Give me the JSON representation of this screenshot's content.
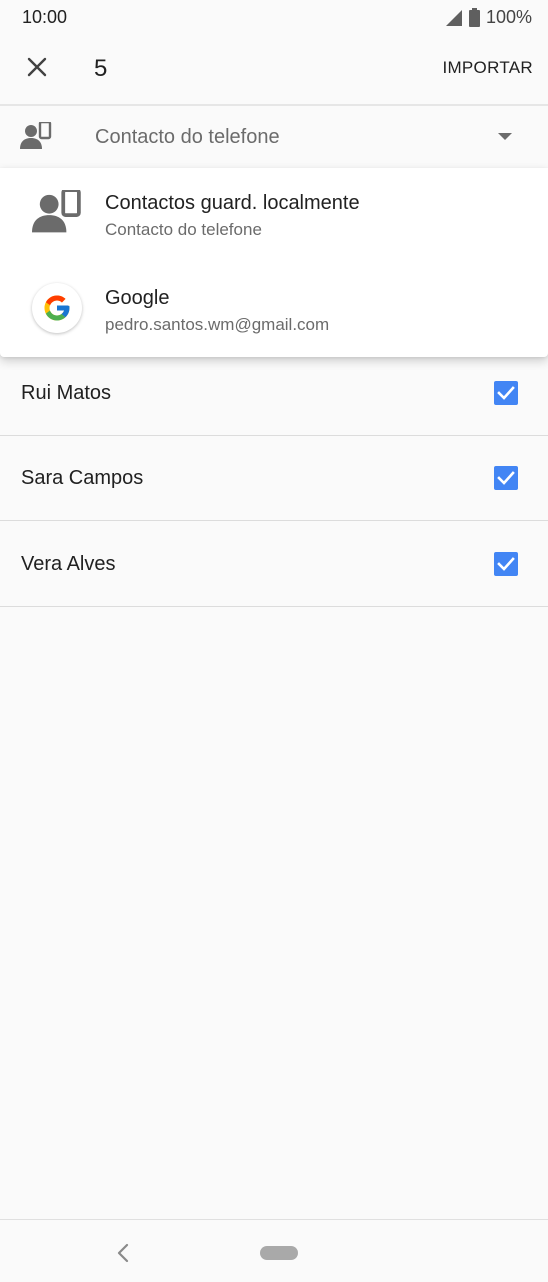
{
  "status_bar": {
    "time": "10:00",
    "battery": "100%",
    "icons": [
      "signal-icon",
      "battery-icon"
    ]
  },
  "toolbar": {
    "count": "5",
    "import_label": "IMPORTAR",
    "close_icon": "close-icon"
  },
  "account_select": {
    "selected": "Contacto do telefone",
    "icon": "phone-contact-icon"
  },
  "dropdown": {
    "items": [
      {
        "title": "Contactos guard. localmente",
        "subtitle": "Contacto do telefone",
        "icon": "phone-contact-icon"
      },
      {
        "title": "Google",
        "subtitle": "pedro.santos.wm@gmail.com",
        "icon": "google-icon"
      }
    ]
  },
  "contacts": [
    {
      "name": "Rui Matos",
      "checked": true
    },
    {
      "name": "Sara Campos",
      "checked": true
    },
    {
      "name": "Vera Alves",
      "checked": true
    }
  ],
  "colors": {
    "checkbox": "#4285f4",
    "background": "#fafafa",
    "text_primary": "#212121",
    "text_secondary": "#6b6b6b"
  }
}
